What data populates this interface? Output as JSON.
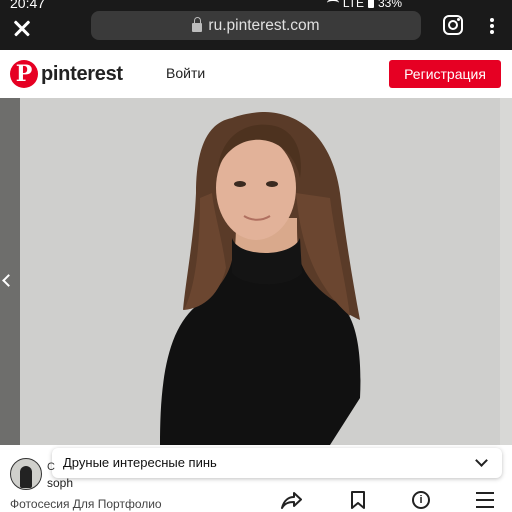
{
  "status_bar": {
    "time": "20:47",
    "network": "LTE",
    "battery": "33%"
  },
  "browser": {
    "url": "ru.pinterest.com"
  },
  "header": {
    "logo_text": "pinterest",
    "logo_glyph": "P",
    "login_label": "Войти",
    "register_label": "Регистрация"
  },
  "more_pins": {
    "label": "Друные интересные пинь"
  },
  "pin": {
    "owner_initial": "C",
    "owner_name": "soph",
    "title": "Фотосесия Для Портфолио",
    "info_glyph": "i"
  },
  "colors": {
    "brand": "#e60023",
    "browser_chrome": "#1a1a1a",
    "photo_backdrop": "#cfcfcd"
  }
}
